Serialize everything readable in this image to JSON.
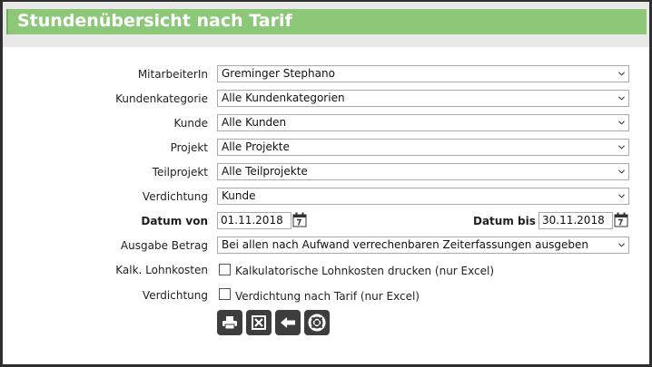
{
  "title": "Stundenübersicht nach Tarif",
  "fields": {
    "mitarbeiter": {
      "label": "MitarbeiterIn",
      "value": "Greminger Stephano"
    },
    "kundenkategorie": {
      "label": "Kundenkategorie",
      "value": "Alle Kundenkategorien"
    },
    "kunde": {
      "label": "Kunde",
      "value": "Alle Kunden"
    },
    "projekt": {
      "label": "Projekt",
      "value": "Alle Projekte"
    },
    "teilprojekt": {
      "label": "Teilprojekt",
      "value": "Alle Teilprojekte"
    },
    "verdichtung": {
      "label": "Verdichtung",
      "value": "Kunde"
    },
    "datum_von": {
      "label": "Datum von",
      "value": "01.11.2018"
    },
    "datum_bis": {
      "label": "Datum bis",
      "value": "30.11.2018"
    },
    "ausgabe_betrag": {
      "label": "Ausgabe Betrag",
      "value": "Bei allen nach Aufwand verrechenbaren Zeiterfassungen ausgeben"
    },
    "lohnkosten": {
      "label": "Kalk. Lohnkosten",
      "text": "Kalkulatorische Lohnkosten drucken (nur Excel)",
      "checked": false
    },
    "verdichtung_tarif": {
      "label": "Verdichtung",
      "text": "Verdichtung nach Tarif (nur Excel)",
      "checked": false
    }
  },
  "buttons": [
    {
      "icon": "print-icon"
    },
    {
      "icon": "excel-icon"
    },
    {
      "icon": "back-arrow-icon"
    },
    {
      "icon": "help-lifebuoy-icon"
    }
  ],
  "colors": {
    "title_bar": "#8dc878",
    "button_bg": "#3d3d3d"
  }
}
